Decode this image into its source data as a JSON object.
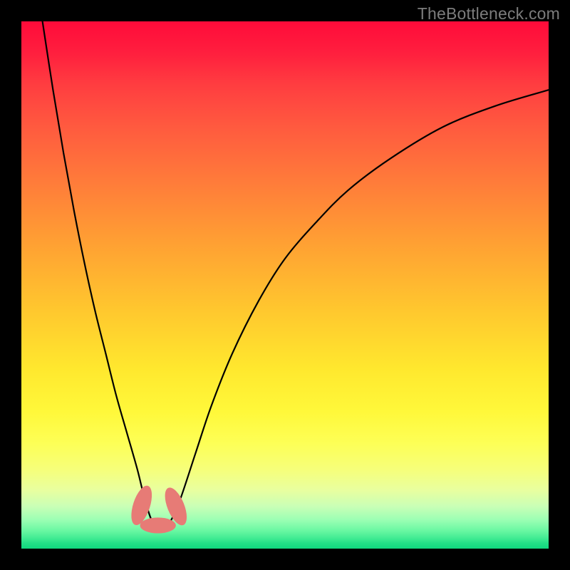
{
  "watermark": {
    "text": "TheBottleneck.com"
  },
  "colors": {
    "curve_stroke": "#000000",
    "marker_fill": "#e77b76",
    "marker_stroke_alpha": 0.0
  },
  "chart_data": {
    "type": "line",
    "title": "",
    "xlabel": "",
    "ylabel": "",
    "xlim": [
      0,
      100
    ],
    "ylim": [
      0,
      100
    ],
    "grid": false,
    "series": [
      {
        "name": "bottleneck-curve",
        "x": [
          4,
          6,
          8,
          10,
          12,
          14,
          16,
          18,
          20,
          22,
          23.5,
          25,
          26.5,
          28,
          30,
          33,
          36,
          40,
          45,
          50,
          56,
          62,
          70,
          80,
          90,
          100
        ],
        "y": [
          100,
          87,
          75,
          64,
          54,
          45,
          37,
          29,
          22,
          15,
          9,
          4.8,
          4.5,
          4.8,
          9,
          18,
          27,
          37,
          47,
          55,
          62,
          68,
          74,
          80,
          84,
          87
        ]
      }
    ],
    "markers": [
      {
        "name": "left-sweet-spot",
        "x": 22.8,
        "y": 8.2,
        "rx": 1.6,
        "ry": 3.9,
        "rotation_deg": 18
      },
      {
        "name": "minimum-point",
        "x": 25.9,
        "y": 4.4,
        "rx": 3.4,
        "ry": 1.5,
        "rotation_deg": 0
      },
      {
        "name": "right-sweet-spot",
        "x": 29.3,
        "y": 8.0,
        "rx": 1.6,
        "ry": 3.8,
        "rotation_deg": -22
      }
    ]
  }
}
